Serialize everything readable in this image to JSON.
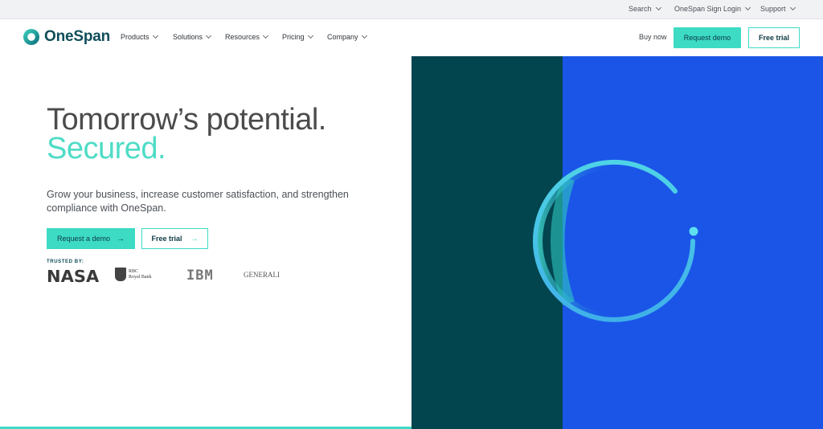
{
  "utility": {
    "search": "Search",
    "signin": "OneSpan Sign Login",
    "support": "Support"
  },
  "nav": {
    "brand": "OneSpan",
    "items": [
      "Products",
      "Solutions",
      "Resources",
      "Pricing",
      "Company"
    ],
    "buy_now": "Buy now",
    "request_demo": "Request demo",
    "free_trial": "Free trial"
  },
  "hero": {
    "title_line1": "Tomorrow’s potential.",
    "title_line2": "Secured.",
    "subtitle": "Grow your business, increase customer satisfaction, and strengthen compliance with OneSpan.",
    "cta_demo": "Request a demo",
    "cta_trial": "Free trial",
    "trusted_by": "TRUSTED BY:",
    "logos": {
      "nasa": "NASA",
      "rbc_line1": "RBC",
      "rbc_line2": "Royal Bank",
      "ibm": "IBM",
      "generali": "GENERALI"
    }
  },
  "colors": {
    "accent": "#3ddbc4",
    "brand_dark": "#0f4d5a",
    "panel_dark": "#02454f",
    "panel_blue": "#1a55e8"
  },
  "icons": [
    "chevron-down-icon",
    "arrow-right-icon",
    "onespan-logo-icon"
  ]
}
